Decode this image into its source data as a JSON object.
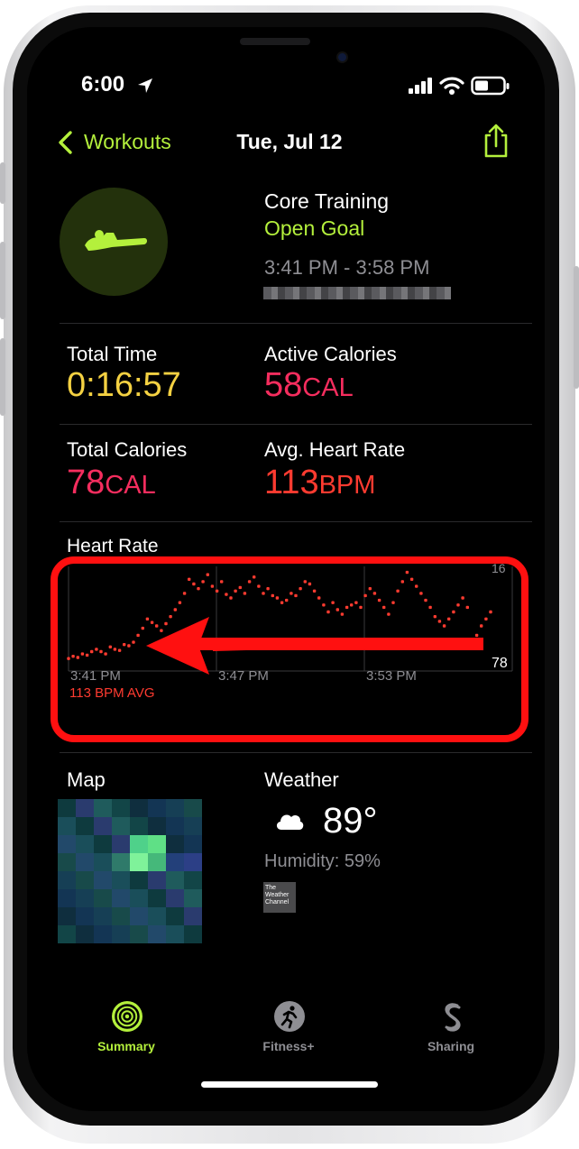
{
  "status_bar": {
    "time": "6:00"
  },
  "nav": {
    "back_label": "Workouts",
    "date": "Tue, Jul 12"
  },
  "workout": {
    "name": "Core Training",
    "goal": "Open Goal",
    "time_range": "3:41 PM - 3:58 PM"
  },
  "metrics": {
    "total_time_label": "Total Time",
    "total_time_value": "0:16:57",
    "active_cal_label": "Active Calories",
    "active_cal_value": "58",
    "active_cal_unit": "CAL",
    "total_cal_label": "Total Calories",
    "total_cal_value": "78",
    "total_cal_unit": "CAL",
    "avg_hr_label": "Avg. Heart Rate",
    "avg_hr_value": "113",
    "avg_hr_unit": "BPM"
  },
  "heart_rate": {
    "title": "Heart Rate",
    "avg_text": "113 BPM AVG",
    "min_label": "78",
    "max_label": "16"
  },
  "chart_data": {
    "type": "scatter",
    "title": "Heart Rate",
    "x_ticks": [
      "3:41 PM",
      "3:47 PM",
      "3:53 PM"
    ],
    "y_min_label": 78,
    "ylim": [
      78,
      160
    ],
    "series": [
      {
        "values": [
          84,
          86,
          85,
          88,
          87,
          90,
          92,
          90,
          88,
          94,
          92,
          91,
          96,
          95,
          98,
          104,
          110,
          118,
          115,
          112,
          108,
          114,
          120,
          126,
          132,
          140,
          152,
          148,
          144,
          150,
          156,
          146,
          142,
          150,
          139,
          136,
          142,
          145,
          140,
          150,
          154,
          146,
          140,
          144,
          138,
          136,
          132,
          134,
          140,
          138,
          144,
          150,
          148,
          142,
          136,
          130,
          124,
          132,
          126,
          122,
          128,
          130,
          132,
          128,
          138,
          144,
          140,
          134,
          128,
          122,
          132,
          142,
          150,
          158,
          152,
          146,
          140,
          134,
          128,
          120,
          116,
          112,
          118,
          124,
          130,
          136,
          128,
          96,
          104,
          112,
          118,
          124
        ]
      }
    ],
    "point_color": "#ff3b30"
  },
  "map": {
    "title": "Map"
  },
  "weather": {
    "title": "Weather",
    "temperature": "89°",
    "humidity": "Humidity: 59%",
    "provider_logo": "The Weather Channel"
  },
  "tab_bar": {
    "items": [
      {
        "label": "Summary"
      },
      {
        "label": "Fitness+"
      },
      {
        "label": "Sharing"
      }
    ]
  }
}
